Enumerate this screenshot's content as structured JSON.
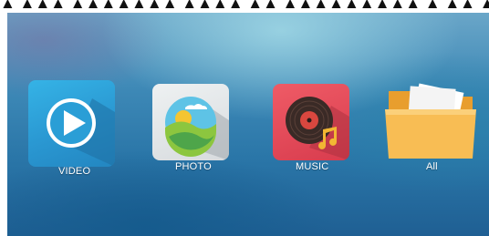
{
  "top_caption": "▲ ▲▲▲ ▲▲▲▲▲▲▲ ▲▲▲▲ ▲▲ ▲▲▲▲▲▲▲▲▲ ▲ ▲▲ ▲▲▲▲▲▲▲",
  "apps": [
    {
      "label": "VIDEO",
      "icon": "play-icon"
    },
    {
      "label": "PHOTO",
      "icon": "landscape-photo-icon"
    },
    {
      "label": "MUSIC",
      "icon": "vinyl-record-icon"
    },
    {
      "label": "All",
      "icon": "folder-icon"
    }
  ],
  "colors": {
    "video": "#2a98d2",
    "photo": "#e4e7e9",
    "music": "#e04a58",
    "folder": "#f7b84d"
  }
}
